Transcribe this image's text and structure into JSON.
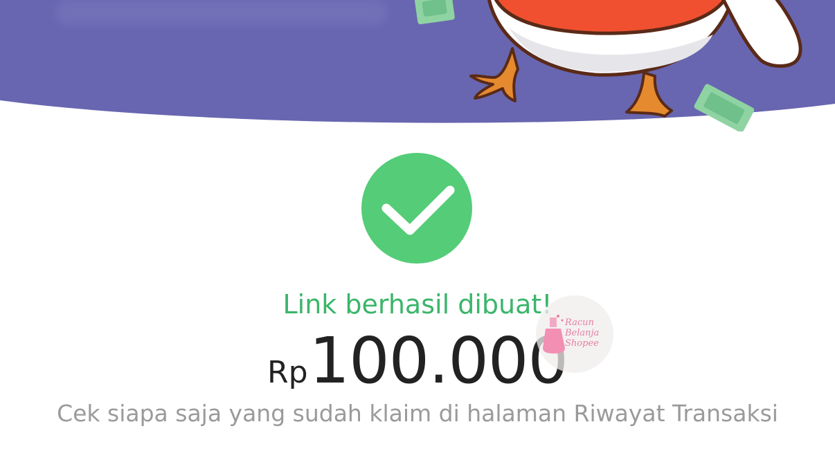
{
  "colors": {
    "banner_purple": "#6866b0",
    "success_green": "#54cc78",
    "title_green": "#3bb56a",
    "amount_text": "#222222",
    "helper_text": "#9a9a9a",
    "mascot_red": "#f0502f",
    "money_green": "#8fd3a3",
    "leg_orange": "#e58a2e"
  },
  "banner": {
    "illustration": "shopee-chicken-mascot-with-money"
  },
  "status": {
    "icon": "checkmark-circle-icon",
    "title": "Link berhasil dibuat!"
  },
  "amount": {
    "currency": "Rp",
    "value": "100.000"
  },
  "helper": {
    "text": "Cek siapa saja yang sudah klaim di halaman Riwayat Transaksi"
  },
  "watermark": {
    "line1": "Racun",
    "line2": "Belanja",
    "line3": "Shopee"
  }
}
